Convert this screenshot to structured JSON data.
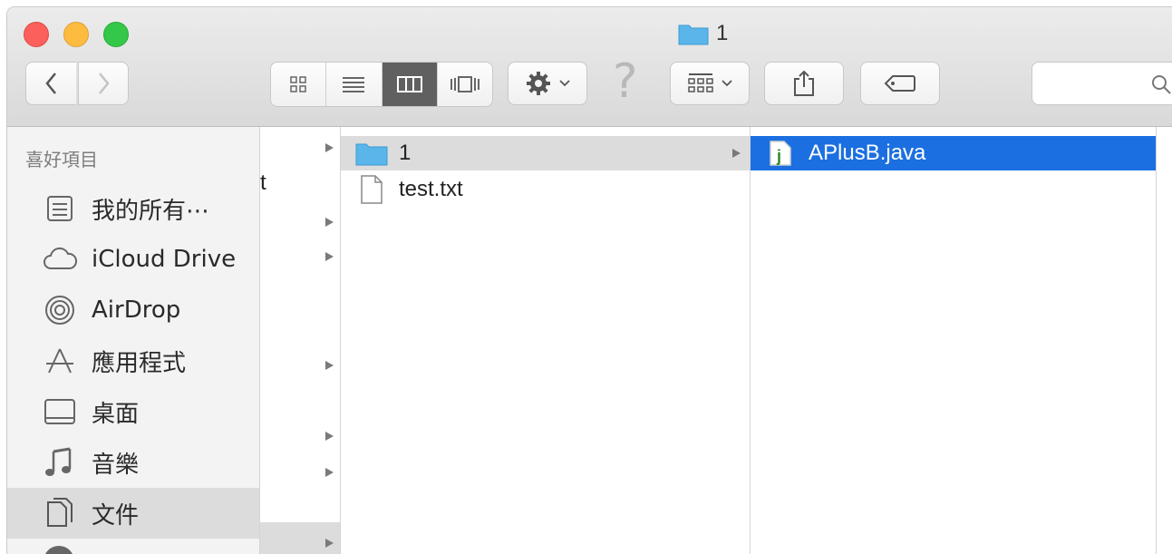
{
  "window": {
    "title": "1"
  },
  "toolbar": {
    "back_icon": "chevron-left-icon",
    "forward_icon": "chevron-right-icon",
    "view_modes": [
      "icon-view-icon",
      "list-view-icon",
      "column-view-icon",
      "coverflow-view-icon"
    ],
    "active_view": "column-view-icon",
    "action_icon": "gear-icon",
    "help_glyph": "?",
    "arrange_icon": "arrange-grid-icon",
    "share_icon": "share-icon",
    "tags_icon": "tag-icon",
    "search_icon": "search-icon"
  },
  "sidebar": {
    "heading": "喜好項目",
    "items": [
      {
        "label": "我的所有⋯",
        "icon": "all-files-icon"
      },
      {
        "label": "iCloud Drive",
        "icon": "cloud-icon"
      },
      {
        "label": "AirDrop",
        "icon": "airdrop-icon"
      },
      {
        "label": "應用程式",
        "icon": "applications-icon"
      },
      {
        "label": "桌面",
        "icon": "desktop-icon"
      },
      {
        "label": "音樂",
        "icon": "music-icon"
      },
      {
        "label": "文件",
        "icon": "documents-icon",
        "selected": true
      }
    ]
  },
  "columns": {
    "col1_partial": "t",
    "col2": [
      {
        "label": "1",
        "icon": "folder-icon",
        "has_children": true,
        "selected": true
      },
      {
        "label": "test.txt",
        "icon": "text-file-icon",
        "has_children": false
      }
    ],
    "col3": [
      {
        "label": "APlusB.java",
        "icon": "java-file-icon",
        "selected": true
      }
    ]
  },
  "colors": {
    "selection_blue": "#1b6fe0",
    "folder_blue": "#5ab6ea"
  }
}
